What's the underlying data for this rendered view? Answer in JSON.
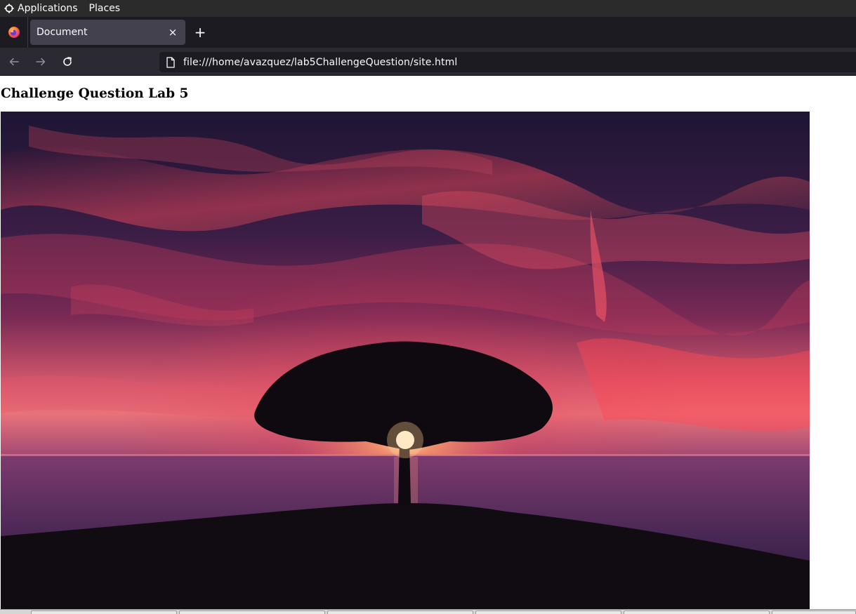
{
  "top_panel": {
    "applications_label": "Applications",
    "places_label": "Places"
  },
  "browser": {
    "tab": {
      "title": "Document",
      "close_glyph": "×"
    },
    "new_tab_glyph": "+",
    "nav": {
      "back_icon": "arrow-left-icon",
      "forward_icon": "arrow-right-icon",
      "reload_icon": "reload-icon"
    },
    "url": "file:///home/avazquez/lab5ChallengeQuestion/site.html"
  },
  "page": {
    "heading": "Challenge Question Lab 5",
    "image": {
      "subject": "tree-silhouette-sunset-photo"
    }
  },
  "colors": {
    "panel_bg": "#2b2b2b",
    "tab_strip_bg": "#1c1b22",
    "active_tab_bg": "#42414d",
    "toolbar_bg": "#2b2a33",
    "urlbar_bg": "#1c1b22",
    "text_light": "#fbfbfe"
  }
}
